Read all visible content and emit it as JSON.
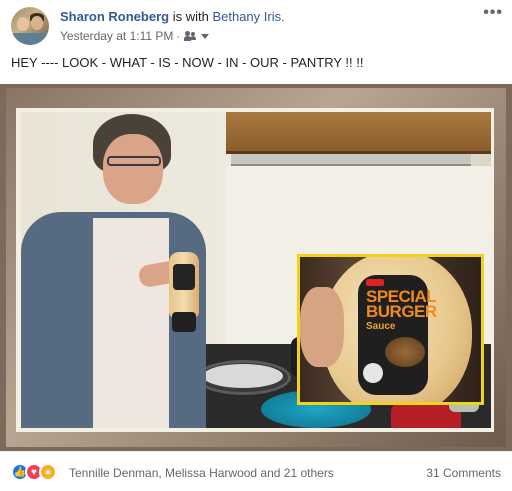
{
  "post": {
    "author": "Sharon Roneberg",
    "with_text": "is with",
    "tagged": "Bethany Iris.",
    "timestamp": "Yesterday at 1:11 PM",
    "separator": "·",
    "audience_icon": "friends-icon",
    "more_label": "•••",
    "text": "HEY ---- LOOK - WHAT - IS - NOW - IN - OUR - PANTRY !! !!"
  },
  "photo": {
    "product_label_line1": "Special",
    "product_label_line2": "Burger",
    "product_label_line3": "Sauce",
    "inset_border_color": "#f1d21c"
  },
  "footer": {
    "reaction_icons": [
      "like-icon",
      "love-icon",
      "wow-icon"
    ],
    "reacted_by": "Tennille Denman, Melissa Harwood and 21 others",
    "comments": "31 Comments"
  },
  "colors": {
    "link": "#365899",
    "muted": "#616770",
    "like": "#1877f2",
    "love": "#f33e58",
    "wow": "#f7b125"
  }
}
